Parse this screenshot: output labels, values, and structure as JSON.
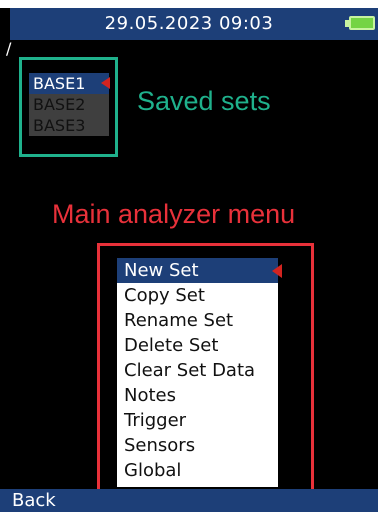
{
  "status_bar": {
    "datetime": "29.05.2023 09:03",
    "battery_icon": "battery-full-icon",
    "battery_color": "#74d444"
  },
  "path": "/",
  "saved_sets": {
    "items": [
      {
        "label": "BASE1",
        "selected": true
      },
      {
        "label": "BASE2",
        "selected": false
      },
      {
        "label": "BASE3",
        "selected": false
      }
    ],
    "annotation": "Saved sets",
    "annotation_color": "#1fb18c"
  },
  "main_menu": {
    "annotation": "Main analyzer menu",
    "annotation_color": "#e8313a",
    "items": [
      {
        "label": "New Set",
        "selected": true
      },
      {
        "label": "Copy Set",
        "selected": false
      },
      {
        "label": "Rename Set",
        "selected": false
      },
      {
        "label": "Delete Set",
        "selected": false
      },
      {
        "label": "Clear Set Data",
        "selected": false
      },
      {
        "label": "Notes",
        "selected": false
      },
      {
        "label": "Trigger",
        "selected": false
      },
      {
        "label": "Sensors",
        "selected": false
      },
      {
        "label": "Global",
        "selected": false
      }
    ]
  },
  "bottom_bar": {
    "back_label": "Back"
  },
  "colors": {
    "header_bg": "#1d3f78",
    "selection_marker": "#d32420"
  }
}
